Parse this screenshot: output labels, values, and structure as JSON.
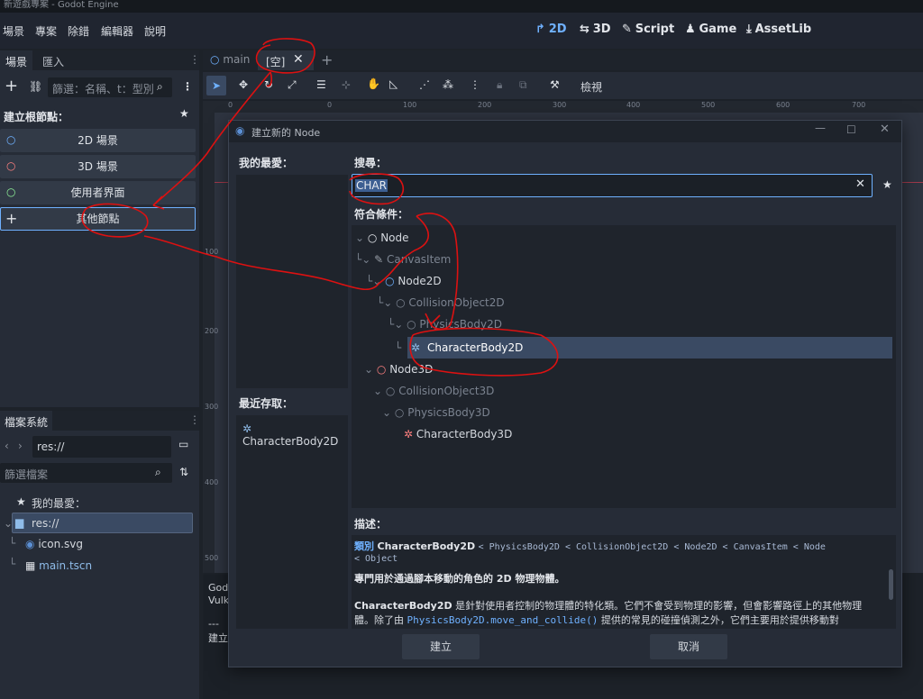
{
  "window_title": "新遊戲專案 - Godot Engine",
  "menu": {
    "items": [
      "場景",
      "專案",
      "除錯",
      "編輯器",
      "說明"
    ],
    "workspaces": [
      "2D",
      "3D",
      "Script",
      "Game",
      "AssetLib"
    ]
  },
  "scene_dock": {
    "tabs": [
      "場景",
      "匯入"
    ],
    "filter_placeholder": "篩選：名稱、t：型別",
    "create_root_label": "建立根節點：",
    "root_buttons": [
      "2D 場景",
      "3D 場景",
      "使用者界面",
      "其他節點"
    ]
  },
  "filesystem": {
    "tab": "檔案系統",
    "path": "res://",
    "filter_placeholder": "篩選檔案",
    "favorites_label": "我的最愛：",
    "items": [
      "res://",
      "icon.svg",
      "main.tscn"
    ]
  },
  "editor_tabs": {
    "tabs": [
      "main",
      "[空]"
    ],
    "view_label": "檢視",
    "ruler_labels": [
      "0",
      "100",
      "200",
      "300",
      "400",
      "500",
      "600",
      "700"
    ],
    "v_ruler_labels": [
      "100",
      "200",
      "300",
      "400",
      "500"
    ]
  },
  "output": {
    "lines": [
      "Godo",
      "Vulk",
      "---",
      "建立"
    ]
  },
  "dialog": {
    "title": "建立新的 Node",
    "favorites_label": "我的最愛：",
    "recent_label": "最近存取：",
    "recent_items": [
      "CharacterBody2D"
    ],
    "search_label": "搜尋：",
    "search_value": "CHAR",
    "matches_label": "符合條件：",
    "tree": [
      {
        "label": "Node",
        "style": "normal"
      },
      {
        "label": "CanvasItem",
        "style": "dim"
      },
      {
        "label": "Node2D",
        "style": "normal"
      },
      {
        "label": "CollisionObject2D",
        "style": "dim"
      },
      {
        "label": "PhysicsBody2D",
        "style": "dim"
      },
      {
        "label": "CharacterBody2D",
        "style": "selected"
      },
      {
        "label": "Node3D",
        "style": "normal"
      },
      {
        "label": "CollisionObject3D",
        "style": "dim"
      },
      {
        "label": "PhysicsBody3D",
        "style": "dim"
      },
      {
        "label": "CharacterBody3D",
        "style": "normal"
      }
    ],
    "description_label": "描述：",
    "desc_class_prefix": "類別",
    "desc_class_name": "CharacterBody2D",
    "desc_inherits": "< PhysicsBody2D < CollisionObject2D < Node2D < CanvasItem < Node",
    "desc_inherits2": "< Object",
    "desc_summary": "專門用於通過腳本移動的角色的 2D 物理物體。",
    "desc_body_name": "CharacterBody2D",
    "desc_body_1": " 是針對使用者控制的物理體的特化類。它們不會受到物理的影響，但會影響路徑上的其他物理",
    "desc_body_2a": "體。除了由 ",
    "desc_body_link": "PhysicsBody2D.move_and_collide()",
    "desc_body_2b": " 提供的常見的碰撞偵測之外，它們主要用於提供移動對",
    "create_button": "建立",
    "cancel_button": "取消"
  },
  "colors": {
    "accent": "#6fb1ff",
    "selected_row": "#3a4a63",
    "annotation_red": "#dd1111"
  }
}
